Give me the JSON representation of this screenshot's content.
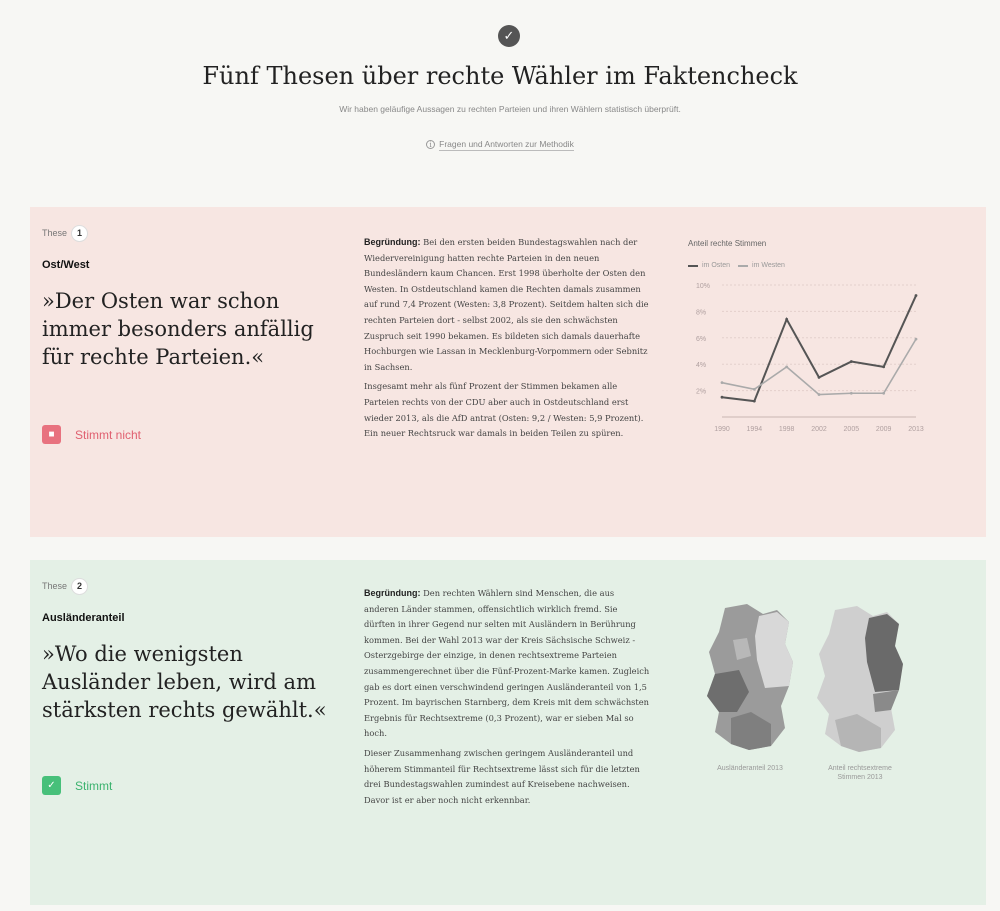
{
  "header": {
    "check_icon": "check-circle-icon",
    "title": "Fünf Thesen über rechte Wähler im Faktencheck",
    "subtitle": "Wir haben geläufige Aussagen zu rechten Parteien und ihren Wählern statistisch überprüft.",
    "method_link": "Fragen und Antworten zur Methodik",
    "info_icon": "info-circle-icon"
  },
  "theses": [
    {
      "these_label": "These",
      "number": "1",
      "topic": "Ost/West",
      "quote": "»Der Osten war schon immer besonders anfällig für rechte Parteien.«",
      "verdict": "Stimmt nicht",
      "verdict_icon": "x-icon",
      "verdict_color": "#e8727f",
      "reason_lead": "Begründung:",
      "reason_p1": "Bei den ersten beiden Bundestagswahlen nach der Wiedervereinigung hatten rechte Parteien in den neuen Bundesländern kaum Chancen. Erst 1998 überholte der Osten den Westen. In Ostdeutschland kamen die Rechten damals zusammen auf rund 7,4 Prozent (Westen: 3,8 Prozent). Seitdem halten sich die rechten Parteien dort - selbst 2002, als sie den schwächsten Zuspruch seit 1990 bekamen. Es bildeten sich damals dauerhafte Hochburgen wie Lassan in Mecklenburg-Vorpommern oder Sebnitz in Sachsen.",
      "reason_p2": "Insgesamt mehr als fünf Prozent der Stimmen bekamen alle Parteien rechts von der CDU aber auch in Ostdeutschland erst wieder 2013, als die AfD antrat (Osten: 9,2 / Westen: 5,9 Prozent). Ein neuer Rechtsruck war damals in beiden Teilen zu spüren."
    },
    {
      "these_label": "These",
      "number": "2",
      "topic": "Ausländeranteil",
      "quote": "»Wo die wenigsten Ausländer leben, wird am stärksten rechts gewählt.«",
      "verdict": "Stimmt",
      "verdict_icon": "check-icon",
      "verdict_color": "#47c07a",
      "reason_lead": "Begründung:",
      "reason_p1": "Den rechten Wählern sind Menschen, die aus anderen Länder stammen, offensichtlich wirklich fremd. Sie dürften in ihrer Gegend nur selten mit Ausländern in Berührung kommen. Bei der Wahl 2013 war der Kreis Sächsische Schweiz - Osterzgebirge der einzige, in denen rechtsextreme Parteien zusammengerechnet über die Fünf-Prozent-Marke kamen. Zugleich gab es dort einen verschwindend geringen Ausländeranteil von 1,5 Prozent. Im bayrischen Starnberg, dem Kreis mit dem schwächsten Ergebnis für Rechtsextreme (0,3 Prozent), war er sieben Mal so hoch.",
      "reason_p2": "Dieser Zusammenhang zwischen geringem Ausländeranteil und höherem Stimmanteil für Rechtsextreme lässt sich für die letzten drei Bundestagswahlen zumindest auf Kreisebene nachweisen. Davor ist er aber noch nicht erkennbar.",
      "map_left_caption": "Ausländeranteil 2013",
      "map_right_caption": "Anteil rechtsextreme Stimmen 2013"
    }
  ],
  "chart_data": {
    "type": "line",
    "title": "Anteil rechte Stimmen",
    "x": [
      "1990",
      "1994",
      "1998",
      "2002",
      "2005",
      "2009",
      "2013"
    ],
    "yticks": [
      "10%",
      "8%",
      "6%",
      "4%",
      "2%"
    ],
    "ylim": [
      0,
      10
    ],
    "series": [
      {
        "name": "im Osten",
        "values": [
          1.5,
          1.2,
          7.4,
          3.0,
          4.2,
          3.8,
          9.2
        ],
        "color": "#555555"
      },
      {
        "name": "im Westen",
        "values": [
          2.6,
          2.1,
          3.8,
          1.7,
          1.8,
          1.8,
          5.9
        ],
        "color": "#aaaaaa"
      }
    ],
    "legend": "top-left",
    "grid": true
  }
}
